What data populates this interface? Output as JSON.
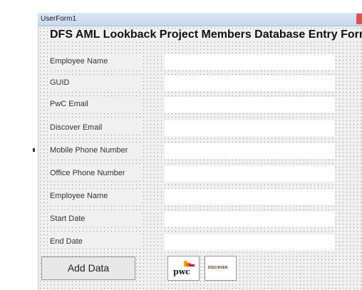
{
  "window": {
    "title": "UserForm1"
  },
  "form": {
    "heading": "DFS AML Lookback Project Members Database Entry Form",
    "fields": [
      {
        "label": "Employee Name",
        "value": ""
      },
      {
        "label": "GUID",
        "value": ""
      },
      {
        "label": "PwC Email",
        "value": ""
      },
      {
        "label": "Discover Email",
        "value": ""
      },
      {
        "label": "Mobile Phone Number",
        "value": ""
      },
      {
        "label": "Office Phone Number",
        "value": ""
      },
      {
        "label": "Employee Name",
        "value": ""
      },
      {
        "label": "Start Date",
        "value": ""
      },
      {
        "label": "End Date",
        "value": ""
      }
    ],
    "add_button": "Add Data",
    "logos": {
      "pwc": "pwc",
      "discover": "DISCOVER"
    }
  },
  "colors": {
    "pwc_orange": "#e86a10",
    "pwc_red": "#c8102e",
    "discover_orange": "#f58220",
    "close_red": "#d9534f"
  }
}
